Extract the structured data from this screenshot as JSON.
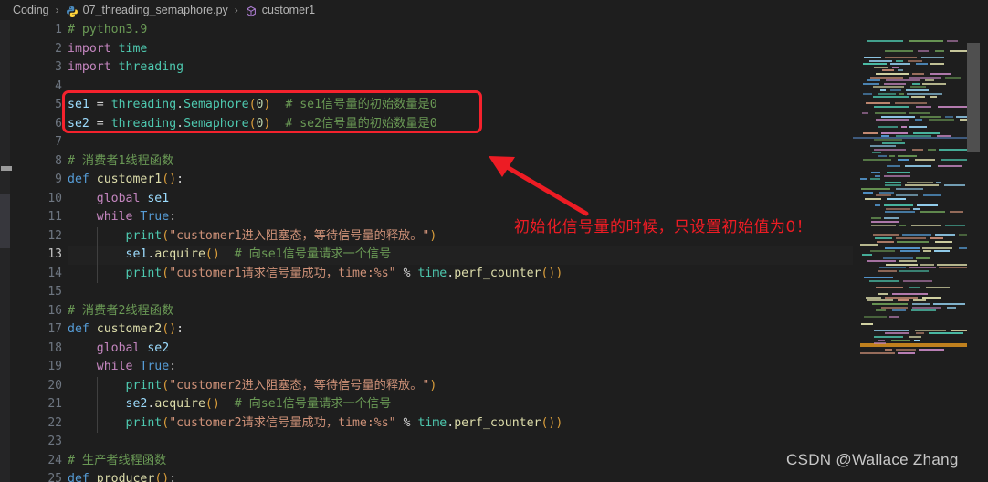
{
  "breadcrumb": {
    "items": [
      {
        "label": "Coding",
        "icon": null
      },
      {
        "label": "07_threading_semaphore.py",
        "icon": "python-file-icon"
      },
      {
        "label": "customer1",
        "icon": "symbol-method-icon"
      }
    ],
    "separator": "›"
  },
  "editor": {
    "language": "python",
    "active_line": 13,
    "first_visible_line": 1,
    "lines": [
      {
        "n": 1,
        "indent": 0,
        "text": "# python3.9"
      },
      {
        "n": 2,
        "indent": 0,
        "text": "import time"
      },
      {
        "n": 3,
        "indent": 0,
        "text": "import threading"
      },
      {
        "n": 4,
        "indent": 0,
        "text": ""
      },
      {
        "n": 5,
        "indent": 0,
        "text": "se1 = threading.Semaphore(0)  # se1信号量的初始数量是0"
      },
      {
        "n": 6,
        "indent": 0,
        "text": "se2 = threading.Semaphore(0)  # se2信号量的初始数量是0"
      },
      {
        "n": 7,
        "indent": 0,
        "text": ""
      },
      {
        "n": 8,
        "indent": 0,
        "text": "# 消费者1线程函数"
      },
      {
        "n": 9,
        "indent": 0,
        "text": "def customer1():"
      },
      {
        "n": 10,
        "indent": 1,
        "text": "    global se1"
      },
      {
        "n": 11,
        "indent": 1,
        "text": "    while True:"
      },
      {
        "n": 12,
        "indent": 2,
        "text": "        print(\"customer1进入阻塞态，等待信号量的释放。\")"
      },
      {
        "n": 13,
        "indent": 2,
        "text": "        se1.acquire()  # 向se1信号量请求一个信号"
      },
      {
        "n": 14,
        "indent": 2,
        "text": "        print(\"customer1请求信号量成功，time:%s\" % time.perf_counter())"
      },
      {
        "n": 15,
        "indent": 0,
        "text": ""
      },
      {
        "n": 16,
        "indent": 0,
        "text": "# 消费者2线程函数"
      },
      {
        "n": 17,
        "indent": 0,
        "text": "def customer2():"
      },
      {
        "n": 18,
        "indent": 1,
        "text": "    global se2"
      },
      {
        "n": 19,
        "indent": 1,
        "text": "    while True:"
      },
      {
        "n": 20,
        "indent": 2,
        "text": "        print(\"customer2进入阻塞态，等待信号量的释放。\")"
      },
      {
        "n": 21,
        "indent": 2,
        "text": "        se2.acquire()  # 向se1信号量请求一个信号"
      },
      {
        "n": 22,
        "indent": 2,
        "text": "        print(\"customer2请求信号量成功，time:%s\" % time.perf_counter())"
      },
      {
        "n": 23,
        "indent": 0,
        "text": ""
      },
      {
        "n": 24,
        "indent": 0,
        "text": "# 生产者线程函数"
      },
      {
        "n": 25,
        "indent": 0,
        "text": "def producer():"
      }
    ]
  },
  "annotation": {
    "text": "初始化信号量的时候，只设置初始值为0！",
    "color": "#ED1C24",
    "highlight_box": {
      "lines": [
        5,
        6
      ],
      "color": "#F5222D"
    }
  },
  "watermark": {
    "text": "CSDN @Wallace Zhang"
  },
  "colors": {
    "background": "#1e1e1e",
    "comment": "#6A9955",
    "keyword": "#C586C0",
    "keyword_decl": "#569CD6",
    "function": "#DCDCAA",
    "class_builtin": "#4EC9B0",
    "variable": "#9CDCFE",
    "string": "#CE9178",
    "number": "#B5CEA8",
    "punctuation": "#D4D4D4",
    "bracket": "#DA9E3B"
  }
}
